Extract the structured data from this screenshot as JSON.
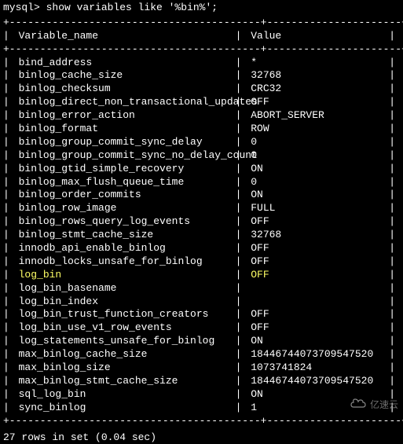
{
  "prompt": "mysql> show variables like '%bin%';",
  "header": {
    "col1": "Variable_name",
    "col2": "Value"
  },
  "border_top": "+-----------------------------------------+----------------------+",
  "border_mid": "+-----------------------------------------+----------------------+",
  "border_bot": "+-----------------------------------------+----------------------+",
  "rows": [
    {
      "name": "bind_address",
      "value": "*",
      "highlight": false
    },
    {
      "name": "binlog_cache_size",
      "value": "32768",
      "highlight": false
    },
    {
      "name": "binlog_checksum",
      "value": "CRC32",
      "highlight": false
    },
    {
      "name": "binlog_direct_non_transactional_updates",
      "value": "OFF",
      "highlight": false
    },
    {
      "name": "binlog_error_action",
      "value": "ABORT_SERVER",
      "highlight": false
    },
    {
      "name": "binlog_format",
      "value": "ROW",
      "highlight": false
    },
    {
      "name": "binlog_group_commit_sync_delay",
      "value": "0",
      "highlight": false
    },
    {
      "name": "binlog_group_commit_sync_no_delay_count",
      "value": "0",
      "highlight": false
    },
    {
      "name": "binlog_gtid_simple_recovery",
      "value": "ON",
      "highlight": false
    },
    {
      "name": "binlog_max_flush_queue_time",
      "value": "0",
      "highlight": false
    },
    {
      "name": "binlog_order_commits",
      "value": "ON",
      "highlight": false
    },
    {
      "name": "binlog_row_image",
      "value": "FULL",
      "highlight": false
    },
    {
      "name": "binlog_rows_query_log_events",
      "value": "OFF",
      "highlight": false
    },
    {
      "name": "binlog_stmt_cache_size",
      "value": "32768",
      "highlight": false
    },
    {
      "name": "innodb_api_enable_binlog",
      "value": "OFF",
      "highlight": false
    },
    {
      "name": "innodb_locks_unsafe_for_binlog",
      "value": "OFF",
      "highlight": false
    },
    {
      "name": "log_bin",
      "value": "OFF",
      "highlight": true
    },
    {
      "name": "log_bin_basename",
      "value": "",
      "highlight": false
    },
    {
      "name": "log_bin_index",
      "value": "",
      "highlight": false
    },
    {
      "name": "log_bin_trust_function_creators",
      "value": "OFF",
      "highlight": false
    },
    {
      "name": "log_bin_use_v1_row_events",
      "value": "OFF",
      "highlight": false
    },
    {
      "name": "log_statements_unsafe_for_binlog",
      "value": "ON",
      "highlight": false
    },
    {
      "name": "max_binlog_cache_size",
      "value": "18446744073709547520",
      "highlight": false
    },
    {
      "name": "max_binlog_size",
      "value": "1073741824",
      "highlight": false
    },
    {
      "name": "max_binlog_stmt_cache_size",
      "value": "18446744073709547520",
      "highlight": false
    },
    {
      "name": "sql_log_bin",
      "value": "ON",
      "highlight": false
    },
    {
      "name": "sync_binlog",
      "value": "1",
      "highlight": false
    }
  ],
  "result": "27 rows in set (0.04 sec)",
  "watermark": "亿速云"
}
